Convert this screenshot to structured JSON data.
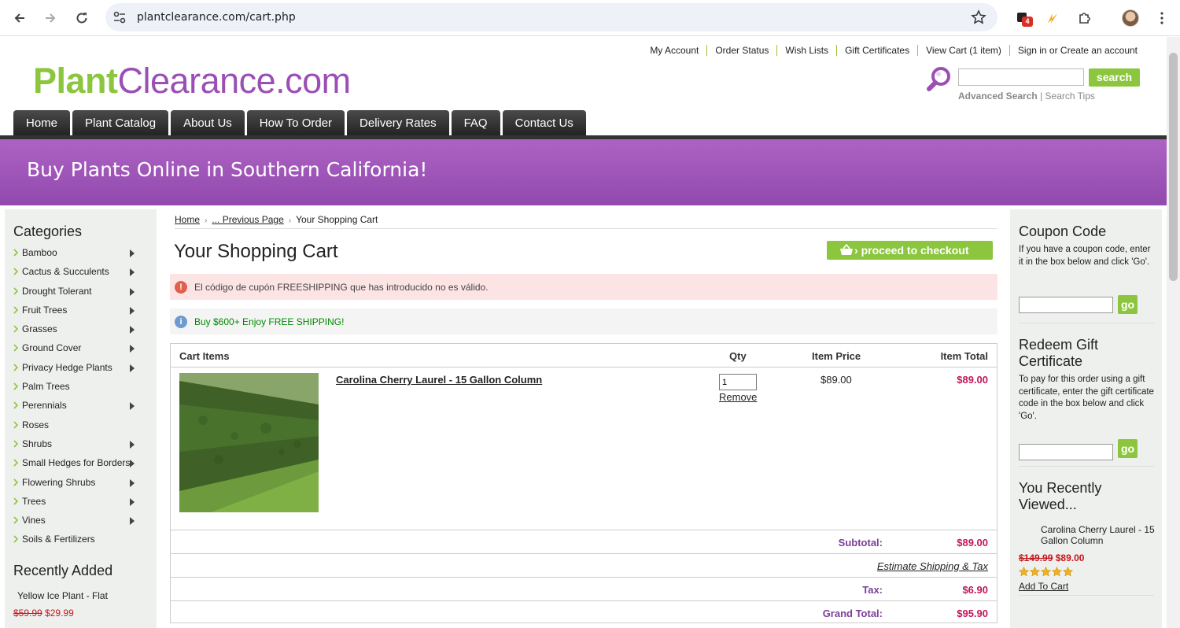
{
  "browser": {
    "url": "plantclearance.com/cart.php",
    "extension_badge": "4"
  },
  "header": {
    "toplinks": [
      "My Account",
      "Order Status",
      "Wish Lists",
      "Gift Certificates",
      "View Cart (1 item)",
      "Sign in or Create an account"
    ],
    "logo_plant": "Plant",
    "logo_clearance": "Clearance.com",
    "search": {
      "placeholder": "",
      "button_label": "search",
      "advanced": "Advanced Search",
      "separator": "|",
      "tips": "Search Tips"
    }
  },
  "nav": [
    "Home",
    "Plant Catalog",
    "About Us",
    "How To Order",
    "Delivery Rates",
    "FAQ",
    "Contact Us"
  ],
  "banner": {
    "title": "Buy Plants Online in Southern California!"
  },
  "sidebar": {
    "categories_title": "Categories",
    "categories": [
      {
        "label": "Bamboo",
        "submenu": true
      },
      {
        "label": "Cactus & Succulents",
        "submenu": true
      },
      {
        "label": "Drought Tolerant",
        "submenu": true
      },
      {
        "label": "Fruit Trees",
        "submenu": true
      },
      {
        "label": "Grasses",
        "submenu": true
      },
      {
        "label": "Ground Cover",
        "submenu": true
      },
      {
        "label": "Privacy Hedge Plants",
        "submenu": true
      },
      {
        "label": "Palm Trees",
        "submenu": false
      },
      {
        "label": "Perennials",
        "submenu": true
      },
      {
        "label": "Roses",
        "submenu": false
      },
      {
        "label": "Shrubs",
        "submenu": true
      },
      {
        "label": "Small Hedges for Borders",
        "submenu": true
      },
      {
        "label": "Flowering Shrubs",
        "submenu": true
      },
      {
        "label": "Trees",
        "submenu": true
      },
      {
        "label": "Vines",
        "submenu": true
      },
      {
        "label": "Soils & Fertilizers",
        "submenu": false
      }
    ],
    "recently_added_title": "Recently Added",
    "recently_added": {
      "name": "Yellow Ice Plant - Flat",
      "old_price": "$59.99",
      "new_price": "$29.99"
    }
  },
  "main": {
    "breadcrumb": [
      "Home",
      "... Previous Page",
      "Your Shopping Cart"
    ],
    "title": "Your Shopping Cart",
    "checkout_label": "proceed to checkout",
    "error_msg": "El código de cupón FREESHIPPING que has introducido no es válido.",
    "info_msg": "Buy $600+ Enjoy FREE SHIPPING!",
    "cart": {
      "headers": {
        "items": "Cart Items",
        "qty": "Qty",
        "price": "Item Price",
        "total": "Item Total"
      },
      "item": {
        "name": "Carolina Cherry Laurel - 15 Gallon Column",
        "qty": "1",
        "remove": "Remove",
        "price": "$89.00",
        "total": "$89.00"
      },
      "subtotal_label": "Subtotal:",
      "subtotal": "$89.00",
      "estimate_label": "Estimate Shipping & Tax",
      "tax_label": "Tax:",
      "tax": "$6.90",
      "grand_total_label": "Grand Total:",
      "grand_total": "$95.90"
    }
  },
  "right": {
    "coupon_title": "Coupon Code",
    "coupon_text": "If you have a coupon code, enter it in the box below and click 'Go'.",
    "go_label": "go",
    "gift_title": "Redeem Gift Certificate",
    "gift_text": "To pay for this order using a gift certificate, enter the gift certificate code in the box below and click 'Go'.",
    "viewed_title": "You Recently Viewed...",
    "viewed_item": {
      "name": "Carolina Cherry Laurel - 15 Gallon Column",
      "old_price": "$149.99",
      "new_price": "$89.00",
      "rating": 5,
      "add_to_cart": "Add To Cart"
    }
  },
  "colors": {
    "brand_green": "#8cc63f",
    "brand_purple": "#9b4fb5",
    "price_red": "#c4165b"
  }
}
